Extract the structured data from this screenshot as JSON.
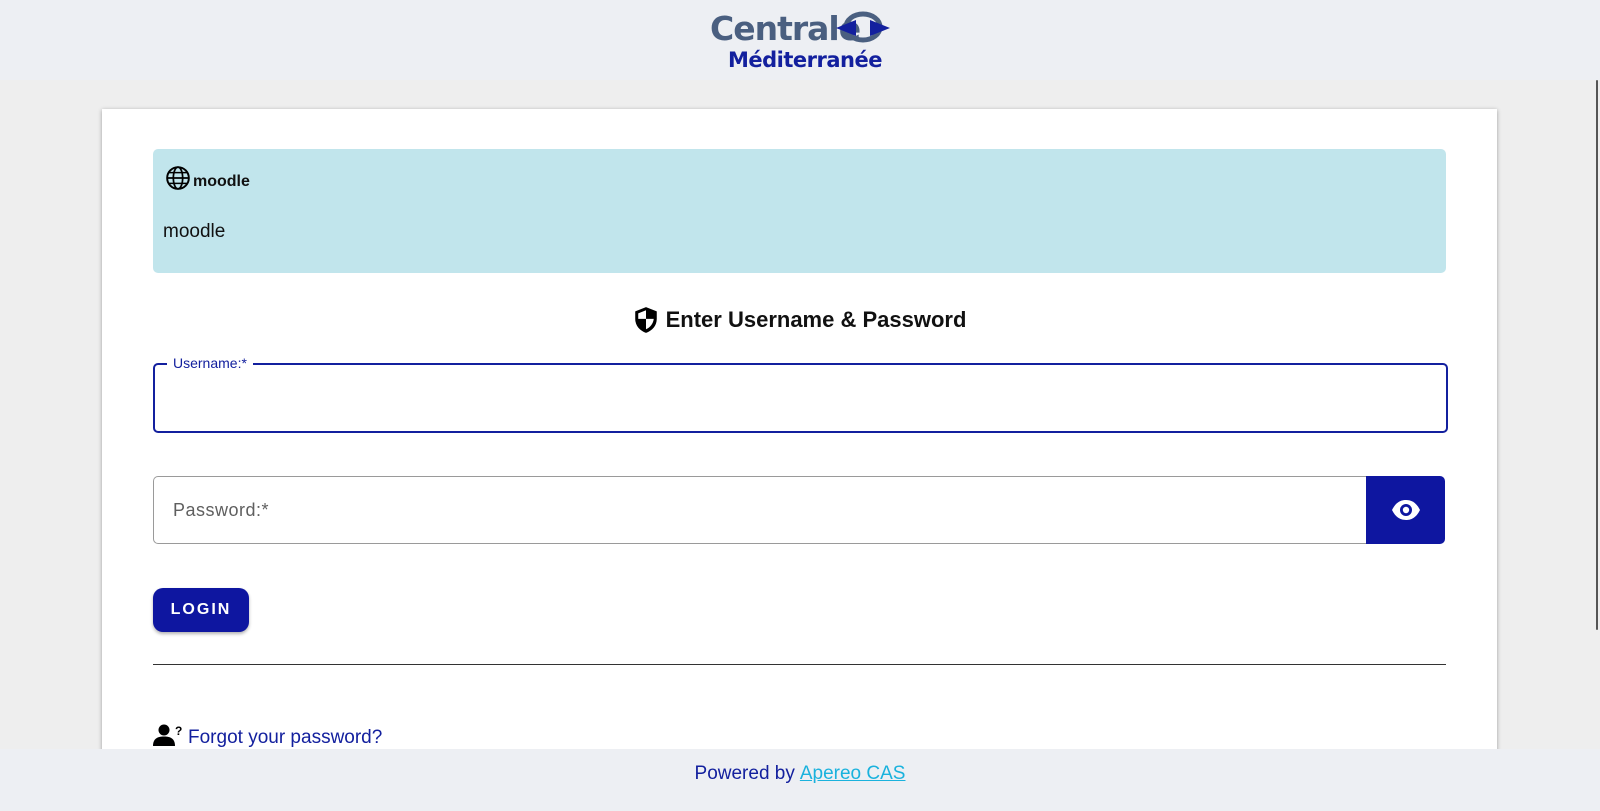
{
  "logo": {
    "line1": "Centrale",
    "line2": "Méditerranée"
  },
  "service": {
    "icon": "globe-icon",
    "title": "moodle",
    "description": "moodle"
  },
  "login": {
    "heading": "Enter Username & Password",
    "heading_icon": "shield-icon",
    "username_label": "Username:*",
    "username_value": "",
    "password_placeholder": "Password:*",
    "password_value": "",
    "toggle_icon": "eye-icon",
    "submit_label": "LOGIN",
    "forgot_label": "Forgot your password?",
    "forgot_icon": "user-question-icon"
  },
  "footer": {
    "prefix": "Powered by",
    "link": "Apereo CAS"
  },
  "colors": {
    "primary": "#0e16a0",
    "service_bg": "#c1e5ec",
    "link": "#1ab2dd",
    "header_bg": "#edeff3"
  }
}
